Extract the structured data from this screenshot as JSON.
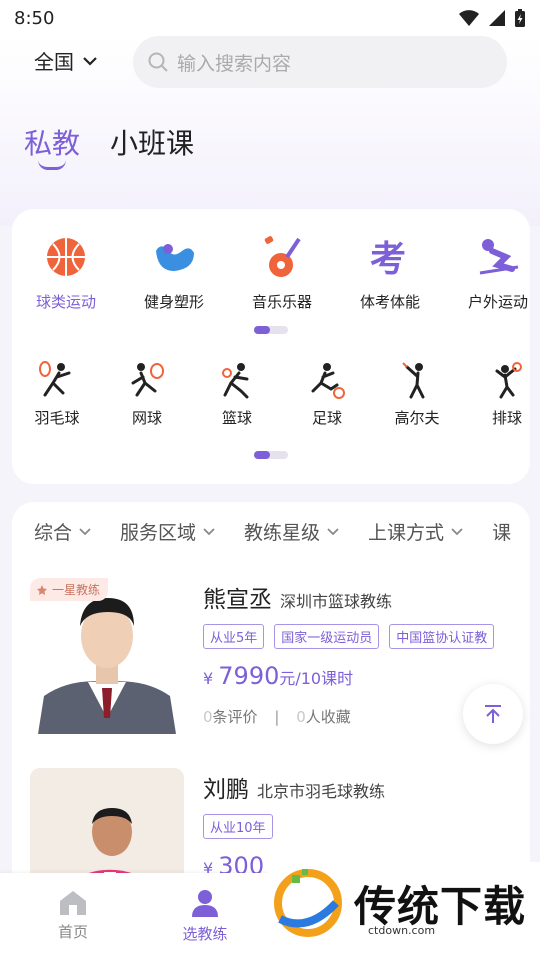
{
  "status_bar": {
    "time": "8:50"
  },
  "header": {
    "region": "全国",
    "search_placeholder": "输入搜索内容",
    "tabs": [
      {
        "label": "私教",
        "active": true
      },
      {
        "label": "小班课",
        "active": false
      }
    ]
  },
  "categories": [
    {
      "label": "球类运动",
      "icon": "basketball-icon",
      "active": true
    },
    {
      "label": "健身塑形",
      "icon": "muscle-arm-icon",
      "active": false
    },
    {
      "label": "音乐乐器",
      "icon": "guitar-icon",
      "active": false
    },
    {
      "label": "体考体能",
      "icon": "exam-icon",
      "active": false
    },
    {
      "label": "户外运动",
      "icon": "skiing-icon",
      "active": false
    }
  ],
  "sports": [
    {
      "label": "羽毛球",
      "icon": "badminton-icon"
    },
    {
      "label": "网球",
      "icon": "tennis-icon"
    },
    {
      "label": "篮球",
      "icon": "basketball-player-icon"
    },
    {
      "label": "足球",
      "icon": "football-icon"
    },
    {
      "label": "高尔夫",
      "icon": "golf-icon"
    },
    {
      "label": "排球",
      "icon": "volleyball-icon"
    }
  ],
  "filters": [
    {
      "label": "综合"
    },
    {
      "label": "服务区域"
    },
    {
      "label": "教练星级"
    },
    {
      "label": "上课方式"
    },
    {
      "label": "课"
    }
  ],
  "coaches": [
    {
      "badge": "一星教练",
      "name": "熊宣丞",
      "title": "深圳市篮球教练",
      "tags": [
        "从业5年",
        "国家一级运动员",
        "中国篮协认证教"
      ],
      "price_symbol": "¥",
      "price": "7990",
      "price_unit": "元/10课时",
      "reviews_num": "0",
      "reviews_label": "条评价",
      "sep": "|",
      "favorites_num": "0",
      "favorites_label": "人收藏"
    },
    {
      "name": "刘鹏",
      "title": "北京市羽毛球教练",
      "tags": [
        "从业10年"
      ],
      "price_symbol": "¥",
      "price": "300"
    }
  ],
  "bottom_nav": [
    {
      "label": "首页",
      "icon": "home-icon",
      "active": false
    },
    {
      "label": "选教练",
      "icon": "person-icon",
      "active": true
    }
  ],
  "watermark": {
    "text": "传统下载",
    "url": "ctdown.com"
  },
  "colors": {
    "accent": "#7d5fd8",
    "orange": "#f0643c",
    "blue": "#3a8fe0"
  }
}
